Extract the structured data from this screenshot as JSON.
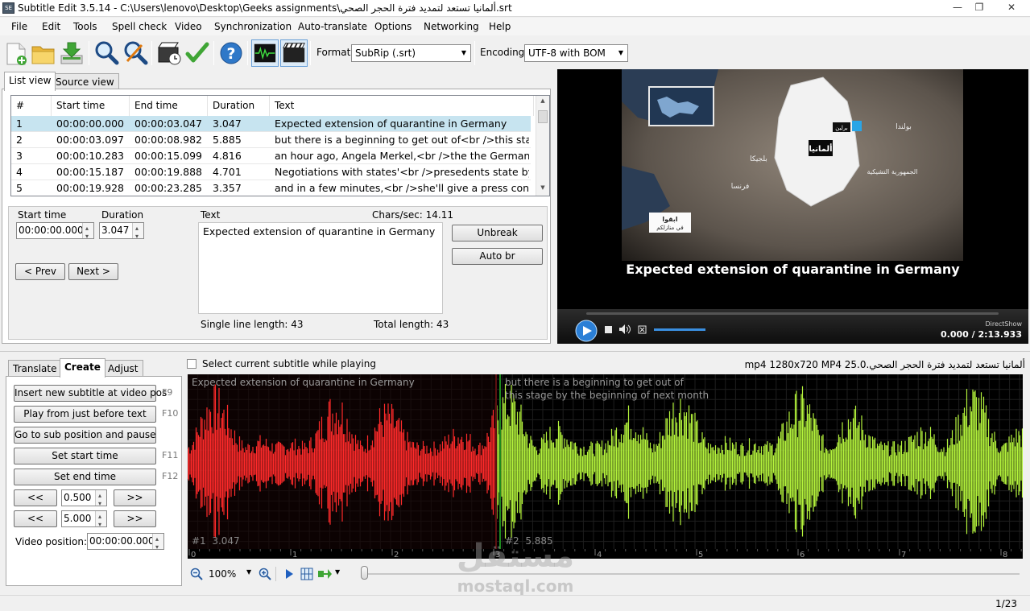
{
  "window": {
    "title": "Subtitle Edit 3.5.14 - C:\\Users\\lenovo\\Desktop\\Geeks assignments\\ألمانيا تستعد لتمديد فترة الحجر الصحي.srt",
    "app_icon_text": "SE"
  },
  "menu": [
    "File",
    "Edit",
    "Tools",
    "Spell check",
    "Video",
    "Synchronization",
    "Auto-translate",
    "Options",
    "Networking",
    "Help"
  ],
  "toolbar": {
    "icons": [
      "new-file-icon",
      "open-folder-icon",
      "save-download-icon",
      "find-icon",
      "replace-icon",
      "visual-sync-icon",
      "spell-check-icon",
      "help-icon",
      "waveform-toggle-icon",
      "video-toggle-icon"
    ],
    "format_label": "Format",
    "format_value": "SubRip (.srt)",
    "encoding_label": "Encoding",
    "encoding_value": "UTF-8 with BOM"
  },
  "view_tabs": {
    "list": "List view",
    "source": "Source view"
  },
  "grid": {
    "columns": [
      "#",
      "Start time",
      "End time",
      "Duration",
      "Text"
    ],
    "rows": [
      {
        "n": "1",
        "start": "00:00:00.000",
        "end": "00:00:03.047",
        "dur": "3.047",
        "text": "Expected extension of quarantine in Germany"
      },
      {
        "n": "2",
        "start": "00:00:03.097",
        "end": "00:00:08.982",
        "dur": "5.885",
        "text": "but there is a beginning to get out of<br />this stag..."
      },
      {
        "n": "3",
        "start": "00:00:10.283",
        "end": "00:00:15.099",
        "dur": "4.816",
        "text": "an hour ago, Angela Merkel,<br />the the German c..."
      },
      {
        "n": "4",
        "start": "00:00:15.187",
        "end": "00:00:19.888",
        "dur": "4.701",
        "text": "Negotiations with states'<br />presedents state by v..."
      },
      {
        "n": "5",
        "start": "00:00:19.928",
        "end": "00:00:23.285",
        "dur": "3.357",
        "text": "and in a few minutes,<br />she'll give a press confe..."
      }
    ]
  },
  "editor": {
    "start_label": "Start time",
    "start_value": "00:00:00.000",
    "duration_label": "Duration",
    "duration_value": "3.047",
    "text_label": "Text",
    "chars_sec": "Chars/sec: 14.11",
    "text_value": "Expected extension of quarantine in Germany",
    "single_line": "Single line length: 43",
    "total_length": "Total length: 43",
    "prev": "< Prev",
    "next": "Next >",
    "unbreak": "Unbreak",
    "autobr": "Auto br"
  },
  "video": {
    "subtitle": "Expected extension of quarantine in Germany",
    "time": "0.000 / 2:13.933",
    "renderer": "DirectShow",
    "map_labels": {
      "germany": "ألمانيا",
      "berlin": "برلين",
      "poland": "بولندا",
      "belgium": "بلجيكا",
      "france": "فرنسا",
      "czech": "الجمهورية التشيكية",
      "stay_home_1": "ابقوا",
      "stay_home_2": "في منازلكم"
    }
  },
  "bottom_tabs": {
    "translate": "Translate",
    "create": "Create",
    "adjust": "Adjust"
  },
  "select_while_playing": "Select current subtitle while playing",
  "media_info": "ألمانيا تستعد لتمديد فترة الحجر الصحي.mp4 1280x720 MP4 25.0",
  "create": {
    "insert": "Insert new subtitle at video pos",
    "insert_key": "F9",
    "play_before": "Play from just before text",
    "play_before_key": "F10",
    "goto_pause": "Go to sub position and pause",
    "set_start": "Set start time",
    "set_start_key": "F11",
    "set_end": "Set end time",
    "set_end_key": "F12",
    "back": "<<",
    "fwd": ">>",
    "step1": "0.500",
    "step2": "5.000",
    "video_pos_label": "Video position:",
    "video_pos_value": "00:00:00.000"
  },
  "waveform": {
    "sub1_text": "Expected extension of quarantine in Germany",
    "sub2_line1": "but there is a beginning to get out of",
    "sub2_line2": "this stage by the beginning of next month",
    "sub1_info": "#1  3.047",
    "sub2_info": "#2  5.885",
    "ticks": [
      "0",
      "1",
      "2",
      "3",
      "4",
      "5",
      "6",
      "7",
      "8"
    ],
    "zoom": "100%",
    "colors": {
      "selected": "#ff2a2a",
      "normal": "#b4f33c",
      "background": "#000000"
    }
  },
  "watermark": {
    "arabic": "مستقل",
    "latin": "mostaql.com"
  },
  "status": "1/23"
}
